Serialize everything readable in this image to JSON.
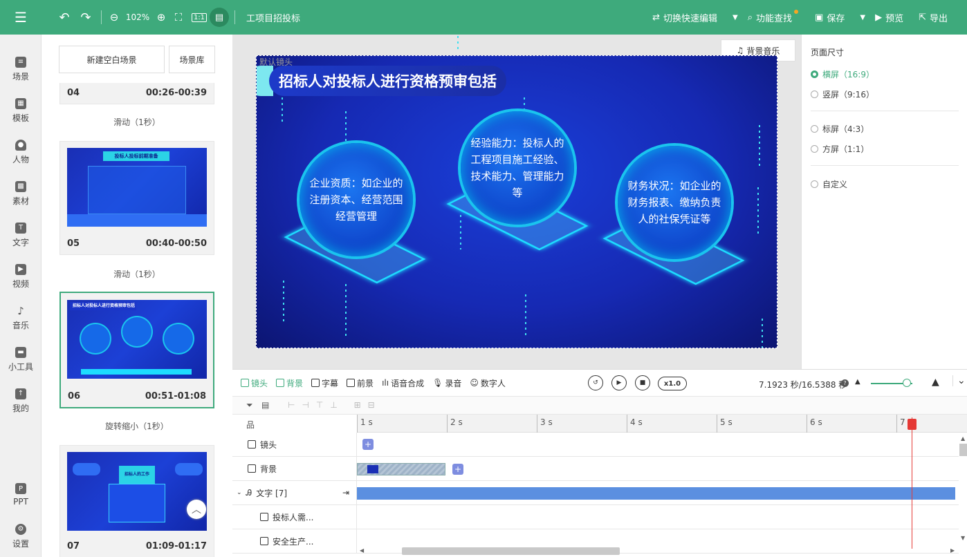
{
  "topbar": {
    "project_title": "工项目招投标",
    "zoom": "102%",
    "actions": [
      "切换快速编辑",
      "功能查找",
      "保存",
      "预览",
      "导出"
    ]
  },
  "leftnav": {
    "items": [
      "场景",
      "模板",
      "人物",
      "素材",
      "文字",
      "视频",
      "音乐",
      "小工具",
      "我的",
      "PPT",
      "设置"
    ]
  },
  "scenes": {
    "new_blank": "新建空白场景",
    "library": "场景库",
    "cards": [
      {
        "num": "04",
        "time": "00:26-00:39",
        "transition": "滑动（1秒）"
      },
      {
        "num": "05",
        "time": "00:40-00:50",
        "transition": "滑动（1秒）",
        "thumb_title": "投标人投标前期准备"
      },
      {
        "num": "06",
        "time": "00:51-01:08",
        "transition": "旋转缩小（1秒）",
        "thumb_title": "招标人对投标人进行资格预审包括"
      },
      {
        "num": "07",
        "time": "01:09-01:17",
        "thumb_title": "招标人的工作"
      }
    ]
  },
  "canvas": {
    "default_lens": "默认镜头",
    "bg_music": "背景音乐",
    "title": "招标人对投标人进行资格预审包括",
    "items": [
      {
        "text": "企业资质：如企业的注册资本、经营范围经营管理"
      },
      {
        "text": "经验能力：投标人的工程项目施工经验、技术能力、管理能力等"
      },
      {
        "text": "财务状况：如企业的财务报表、缴纳负责人的社保凭证等"
      }
    ]
  },
  "rightpanel": {
    "title": "页面尺寸",
    "options": [
      "横屏（16:9）",
      "竖屏（9:16）",
      "标屏（4:3）",
      "方屏（1:1）",
      "自定义"
    ],
    "selected": "横屏（16:9）"
  },
  "timeline": {
    "tabs": [
      "镜头",
      "背景",
      "字幕",
      "前景",
      "语音合成",
      "录音",
      "数字人"
    ],
    "speed": "x1.0",
    "time": "7.1923 秒/16.5388 秒",
    "ruler": [
      "1 s",
      "2 s",
      "3 s",
      "4 s",
      "5 s",
      "6 s",
      "7 s"
    ],
    "tracks": [
      "镜头",
      "背景",
      "文字 [7]",
      "投标人需...",
      "安全生产..."
    ]
  },
  "colors": {
    "accent": "#3eaa7c",
    "playhead": "#e53935",
    "text_clip": "#5b8fe0"
  }
}
